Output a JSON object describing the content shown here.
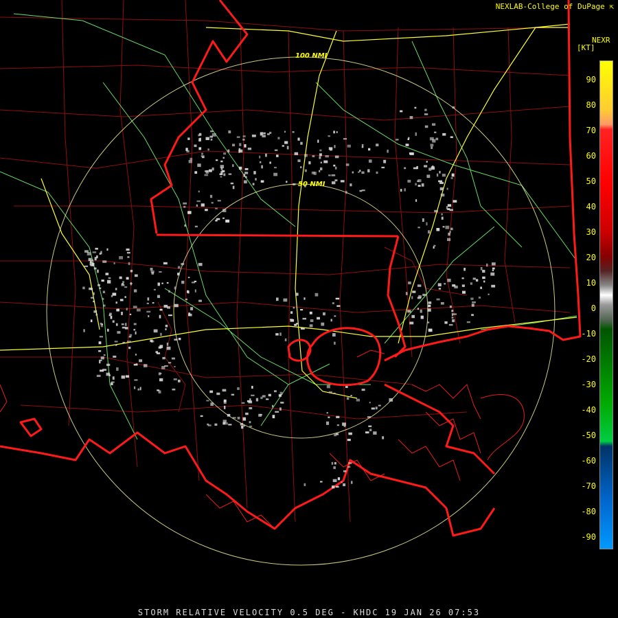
{
  "credit": "NEXLAB-College of DuPage",
  "credit_icon": "external-link-icon",
  "caption": "STORM RELATIVE VELOCITY 0.5 DEG - KHDC 19 JAN 26 07:53",
  "legend": {
    "title": "NEXR",
    "unit": "[KT]",
    "ticks": [
      "90",
      "80",
      "70",
      "60",
      "50",
      "40",
      "30",
      "20",
      "10",
      "0",
      "-10",
      "-20",
      "-30",
      "-40",
      "-50",
      "-60",
      "-70",
      "-80",
      "-90"
    ]
  },
  "range_rings": [
    "100 NMI",
    "50 NMI"
  ],
  "colors": {
    "state_border": "#ff1a1a",
    "county_border": "#b01010",
    "highway": "#66dd66",
    "interstate": "#ffff33",
    "range_ring": "#ffffaa",
    "echo": "#d8d8d8",
    "text": "#ffff00"
  }
}
